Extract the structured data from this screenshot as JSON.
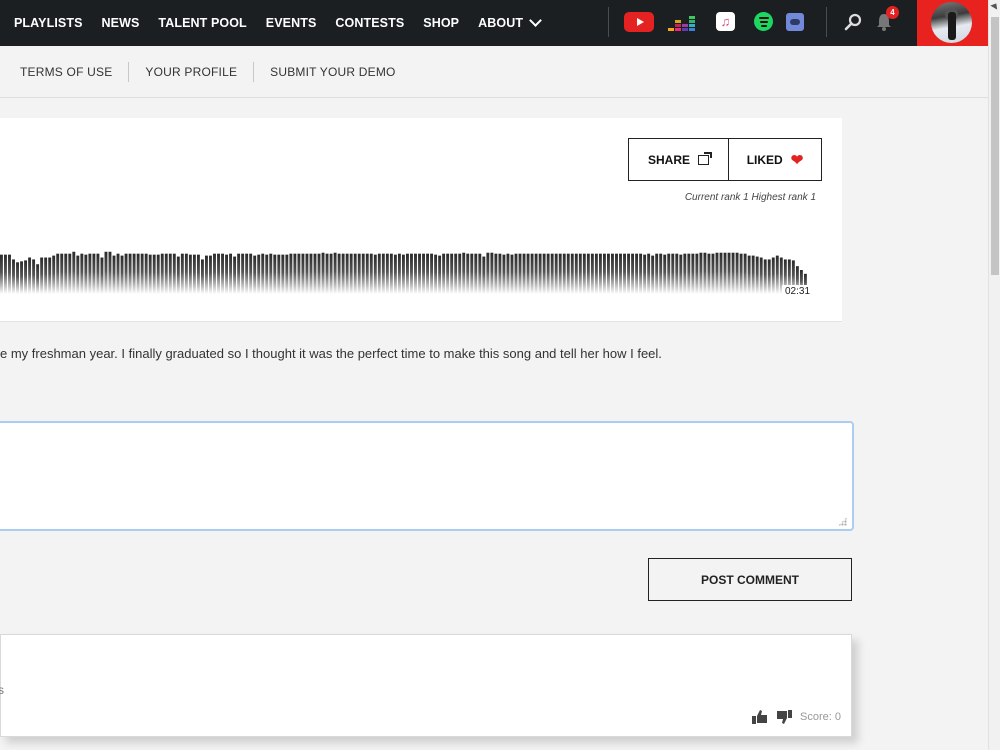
{
  "nav": {
    "links": [
      "PLAYLISTS",
      "NEWS",
      "TALENT POOL",
      "EVENTS",
      "CONTESTS",
      "SHOP"
    ],
    "about_label": "ABOUT",
    "social_icons": [
      "youtube-icon",
      "deezer-icon",
      "apple-music-icon",
      "spotify-icon",
      "discord-icon"
    ],
    "notification_count": "4",
    "accent_color": "#e8221e"
  },
  "subnav": {
    "links": [
      "TERMS OF USE",
      "YOUR PROFILE",
      "SUBMIT YOUR DEMO"
    ]
  },
  "player": {
    "share_label": "SHARE",
    "liked_label": "LIKED",
    "rank_text": "Current rank 1  Highest rank 1",
    "duration": "02:31",
    "waveform_levels": [
      0.82,
      0.82,
      0.82,
      0.72,
      0.66,
      0.68,
      0.7,
      0.76,
      0.72,
      0.62,
      0.76,
      0.76,
      0.76,
      0.8,
      0.84,
      0.84,
      0.84,
      0.84,
      0.88,
      0.8,
      0.84,
      0.82,
      0.84,
      0.84,
      0.84,
      0.76,
      0.88,
      0.88,
      0.8,
      0.84,
      0.8,
      0.84,
      0.84,
      0.84,
      0.84,
      0.84,
      0.84,
      0.82,
      0.82,
      0.82,
      0.84,
      0.84,
      0.84,
      0.84,
      0.78,
      0.84,
      0.84,
      0.82,
      0.82,
      0.82,
      0.72,
      0.8,
      0.8,
      0.84,
      0.84,
      0.84,
      0.82,
      0.84,
      0.78,
      0.84,
      0.84,
      0.84,
      0.84,
      0.8,
      0.82,
      0.84,
      0.82,
      0.84,
      0.82,
      0.82,
      0.82,
      0.82,
      0.84,
      0.84,
      0.84,
      0.84,
      0.84,
      0.84,
      0.84,
      0.84,
      0.86,
      0.84,
      0.84,
      0.86,
      0.84,
      0.84,
      0.84,
      0.84,
      0.84,
      0.84,
      0.84,
      0.84,
      0.84,
      0.82,
      0.84,
      0.84,
      0.84,
      0.84,
      0.82,
      0.84,
      0.82,
      0.84,
      0.84,
      0.84,
      0.84,
      0.84,
      0.84,
      0.84,
      0.82,
      0.8,
      0.84,
      0.84,
      0.84,
      0.84,
      0.84,
      0.86,
      0.84,
      0.84,
      0.84,
      0.84,
      0.78,
      0.86,
      0.86,
      0.84,
      0.84,
      0.82,
      0.84,
      0.82,
      0.84,
      0.84,
      0.84,
      0.84,
      0.84,
      0.84,
      0.84,
      0.84,
      0.84,
      0.84,
      0.84,
      0.84,
      0.84,
      0.84,
      0.84,
      0.84,
      0.84,
      0.84,
      0.84,
      0.84,
      0.84,
      0.84,
      0.84,
      0.84,
      0.84,
      0.84,
      0.84,
      0.84,
      0.84,
      0.84,
      0.84,
      0.84,
      0.82,
      0.84,
      0.8,
      0.84,
      0.84,
      0.82,
      0.84,
      0.84,
      0.84,
      0.82,
      0.84,
      0.84,
      0.84,
      0.84,
      0.86,
      0.86,
      0.84,
      0.84,
      0.86,
      0.86,
      0.86,
      0.86,
      0.86,
      0.86,
      0.84,
      0.84,
      0.8,
      0.8,
      0.78,
      0.76,
      0.72,
      0.72,
      0.76,
      0.8,
      0.76,
      0.72,
      0.72,
      0.7,
      0.58,
      0.5,
      0.42
    ]
  },
  "description": "e my freshman year. I finally graduated so I thought it was the perfect time to make this song and tell her how I feel.",
  "comment_form": {
    "value": "",
    "placeholder": "",
    "post_label": "POST COMMENT"
  },
  "comments": [
    {
      "author_fragment": "s",
      "score_text": "Score: 0"
    }
  ]
}
